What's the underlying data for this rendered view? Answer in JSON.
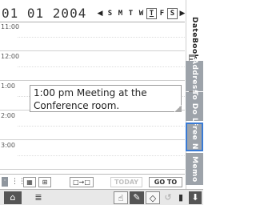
{
  "header": {
    "date": "01 01 2004",
    "prev_arrow": "◀",
    "next_arrow": "▶",
    "weekdays": [
      "S",
      "M",
      "T",
      "W",
      "T",
      "F",
      "S"
    ],
    "today_index": 4
  },
  "schedule": {
    "hours": [
      "11:00",
      "12:00",
      "1:00",
      "2:00",
      "3:00"
    ],
    "event_text": "1:00 pm  Meeting at the Conference room."
  },
  "side_tabs": {
    "date_book": "DateBook",
    "address": "Address",
    "todo": "To Do L",
    "free_notes": "Free N.",
    "memo": "Memo"
  },
  "toolbar": {
    "view_day": "·",
    "view_week": "⋮⋮",
    "view_month": "▦",
    "view_year": "⊞",
    "move": "□→□",
    "today": "TODAY",
    "goto": "GO TO"
  },
  "statusbar": {
    "home": "⌂",
    "menu": "≣",
    "pointer": "☝",
    "pen": "✎",
    "eraser": "◇",
    "undo": "↺",
    "battery": "▮",
    "scroll_down": "⬇"
  },
  "colors": {
    "accent": "#3a7bd5",
    "tab_dark": "#9da3aa",
    "grid": "#d0d0d0"
  }
}
